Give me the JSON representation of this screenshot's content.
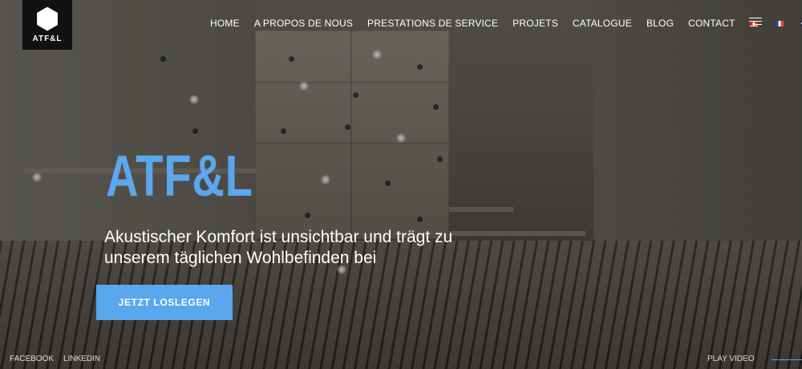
{
  "logo": {
    "text": "ATF&L"
  },
  "nav": {
    "items": [
      "HOME",
      "A PROPOS DE NOUS",
      "PRESTATIONS DE SERVICE",
      "PROJETS",
      "CATALOGUE",
      "BLOG",
      "CONTACT"
    ],
    "languages": [
      "flag-ch-icon",
      "flag-fr-icon",
      "flag-gb-icon"
    ],
    "active_language": "flag-ch-icon"
  },
  "hero": {
    "title": "ATF&L",
    "subtitle": "Akustischer Komfort ist unsichtbar und trägt zu unserem täglichen Wohlbefinden bei",
    "cta_label": "JETZT LOSLEGEN"
  },
  "footer": {
    "social": [
      "FACEBOOK",
      "LINKEDIN"
    ],
    "play_label": "PLAY VIDEO"
  },
  "colors": {
    "accent": "#5aa7ee",
    "logo_bg": "#111111"
  }
}
